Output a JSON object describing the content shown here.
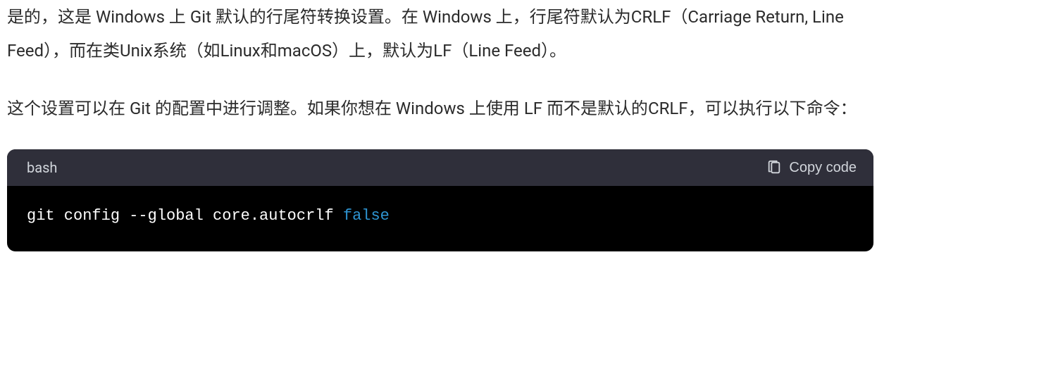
{
  "paragraphs": {
    "p1": "是的，这是 Windows 上 Git 默认的行尾符转换设置。在 Windows 上，行尾符默认为CRLF（Carriage Return, Line Feed），而在类Unix系统（如Linux和macOS）上，默认为LF（Line Feed）。",
    "p2": "这个设置可以在 Git 的配置中进行调整。如果你想在 Windows 上使用 LF 而不是默认的CRLF，可以执行以下命令："
  },
  "codeblock": {
    "language": "bash",
    "copy_label": "Copy code",
    "code_prefix": "git config --global core.autocrlf ",
    "code_highlight": "false"
  }
}
